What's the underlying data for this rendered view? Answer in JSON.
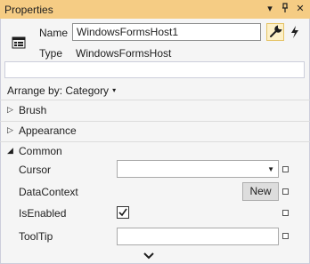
{
  "window": {
    "title": "Properties",
    "dropdown_glyph": "▾",
    "pin_glyph": "⊥",
    "close_glyph": "✕"
  },
  "header": {
    "name_label": "Name",
    "name_value": "WindowsFormsHost1",
    "type_label": "Type",
    "type_value": "WindowsFormsHost"
  },
  "search": {
    "placeholder": "",
    "value": ""
  },
  "arrange": {
    "label": "Arrange by: Category",
    "caret": "▾"
  },
  "categories": [
    {
      "label": "Brush",
      "arrow": "▷"
    },
    {
      "label": "Appearance",
      "arrow": "▷"
    },
    {
      "label": "Common",
      "arrow": "◢"
    }
  ],
  "properties": [
    {
      "label": "Cursor",
      "value": ""
    },
    {
      "label": "DataContext",
      "button": "New"
    },
    {
      "label": "IsEnabled",
      "checked": true
    },
    {
      "label": "ToolTip",
      "value": ""
    }
  ],
  "colors": {
    "title_bar": "#f5cc84",
    "panel_bg": "#f5f5f5",
    "accent_button": "#fdf0c8"
  }
}
